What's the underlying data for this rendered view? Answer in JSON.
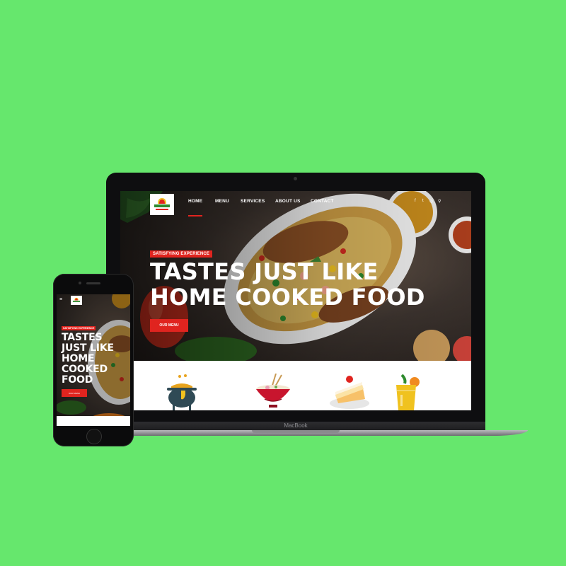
{
  "background_color": "#66e76d",
  "accent_color": "#e0241f",
  "laptop": {
    "brand_label": "MacBook",
    "nav": {
      "logo_icon": "mama-kitchen-logo-icon",
      "items": [
        {
          "label": "HOME",
          "active": true
        },
        {
          "label": "MENU",
          "active": false
        },
        {
          "label": "SERVICES",
          "active": false
        },
        {
          "label": "ABOUT US",
          "active": false
        },
        {
          "label": "CONTACT",
          "active": false
        }
      ],
      "social": [
        "f",
        "t",
        "◎",
        "⚲"
      ]
    },
    "hero": {
      "tag": "SATISFYING EXPERIENCE",
      "headline_line1": "TASTES JUST LIKE",
      "headline_line2": "HOME COOKED FOOD",
      "cta": "OUR MENU"
    },
    "service_icons": [
      "cooking-pot-icon",
      "noodle-bowl-icon",
      "cake-slice-icon",
      "juice-glass-icon"
    ]
  },
  "phone": {
    "menu_icon": "≡",
    "hero": {
      "tag": "SATISFYING EXPERIENCE",
      "headline": [
        "TASTES",
        "JUST LIKE",
        "HOME",
        "COOKED",
        "FOOD"
      ],
      "cta": "OUR MENU"
    }
  }
}
